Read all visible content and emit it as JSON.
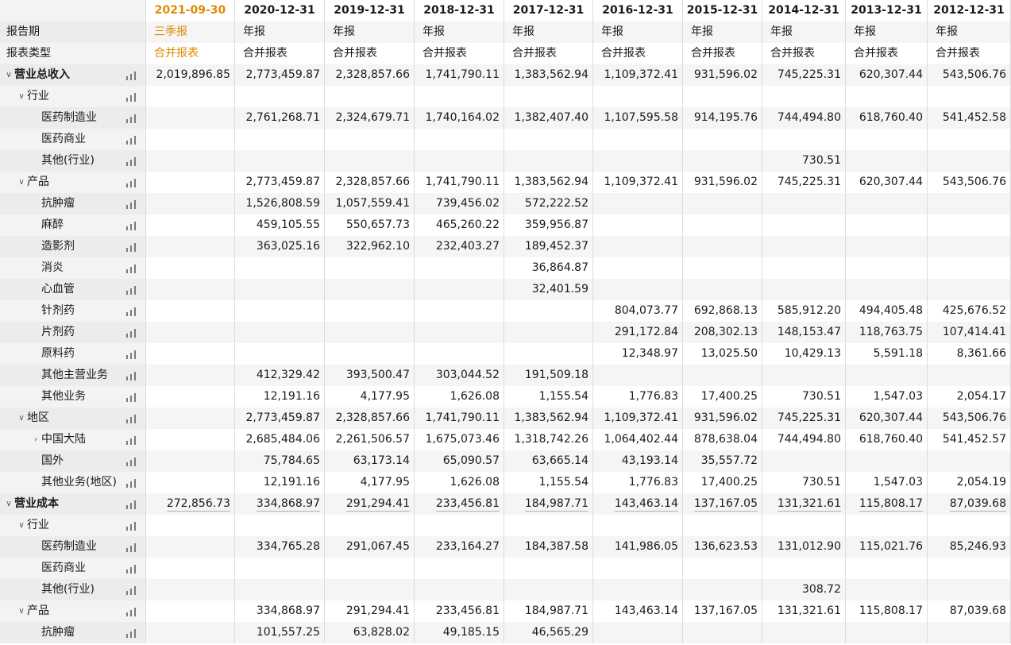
{
  "columns": [
    "2021-09-30",
    "2020-12-31",
    "2019-12-31",
    "2018-12-31",
    "2017-12-31",
    "2016-12-31",
    "2015-12-31",
    "2014-12-31",
    "2013-12-31",
    "2012-12-31"
  ],
  "highlight_column": 0,
  "accent_color": "#e08a00",
  "rows": [
    {
      "label": "报告期",
      "values": [
        "三季报",
        "年报",
        "年报",
        "年报",
        "年报",
        "年报",
        "年报",
        "年报",
        "年报",
        "年报"
      ],
      "indent": 0,
      "text_row": true
    },
    {
      "label": "报表类型",
      "values": [
        "合并报表",
        "合并报表",
        "合并报表",
        "合并报表",
        "合并报表",
        "合并报表",
        "合并报表",
        "合并报表",
        "合并报表",
        "合并报表"
      ],
      "indent": 0,
      "text_row": true
    },
    {
      "label": "营业总收入",
      "values": [
        "2,019,896.85",
        "2,773,459.87",
        "2,328,857.66",
        "1,741,790.11",
        "1,383,562.94",
        "1,109,372.41",
        "931,596.02",
        "745,225.31",
        "620,307.44",
        "543,506.76"
      ],
      "indent": 0,
      "toggle": "v",
      "bold": true,
      "chart": true
    },
    {
      "label": "行业",
      "values": [
        "",
        "",
        "",
        "",
        "",
        "",
        "",
        "",
        "",
        ""
      ],
      "indent": 1,
      "toggle": "v",
      "chart": true
    },
    {
      "label": "医药制造业",
      "values": [
        "",
        "2,761,268.71",
        "2,324,679.71",
        "1,740,164.02",
        "1,382,407.40",
        "1,107,595.58",
        "914,195.76",
        "744,494.80",
        "618,760.40",
        "541,452.58"
      ],
      "indent": 2,
      "chart": true
    },
    {
      "label": "医药商业",
      "values": [
        "",
        "",
        "",
        "",
        "",
        "",
        "",
        "",
        "",
        ""
      ],
      "indent": 2,
      "chart": true
    },
    {
      "label": "其他(行业)",
      "values": [
        "",
        "",
        "",
        "",
        "",
        "",
        "",
        "730.51",
        "",
        ""
      ],
      "indent": 2,
      "chart": true
    },
    {
      "label": "产品",
      "values": [
        "",
        "2,773,459.87",
        "2,328,857.66",
        "1,741,790.11",
        "1,383,562.94",
        "1,109,372.41",
        "931,596.02",
        "745,225.31",
        "620,307.44",
        "543,506.76"
      ],
      "indent": 1,
      "toggle": "v",
      "chart": true
    },
    {
      "label": "抗肿瘤",
      "values": [
        "",
        "1,526,808.59",
        "1,057,559.41",
        "739,456.02",
        "572,222.52",
        "",
        "",
        "",
        "",
        ""
      ],
      "indent": 2,
      "chart": true
    },
    {
      "label": "麻醉",
      "values": [
        "",
        "459,105.55",
        "550,657.73",
        "465,260.22",
        "359,956.87",
        "",
        "",
        "",
        "",
        ""
      ],
      "indent": 2,
      "chart": true
    },
    {
      "label": "造影剂",
      "values": [
        "",
        "363,025.16",
        "322,962.10",
        "232,403.27",
        "189,452.37",
        "",
        "",
        "",
        "",
        ""
      ],
      "indent": 2,
      "chart": true
    },
    {
      "label": "消炎",
      "values": [
        "",
        "",
        "",
        "",
        "36,864.87",
        "",
        "",
        "",
        "",
        ""
      ],
      "indent": 2,
      "chart": true
    },
    {
      "label": "心血管",
      "values": [
        "",
        "",
        "",
        "",
        "32,401.59",
        "",
        "",
        "",
        "",
        ""
      ],
      "indent": 2,
      "chart": true
    },
    {
      "label": "针剂药",
      "values": [
        "",
        "",
        "",
        "",
        "",
        "804,073.77",
        "692,868.13",
        "585,912.20",
        "494,405.48",
        "425,676.52"
      ],
      "indent": 2,
      "chart": true
    },
    {
      "label": "片剂药",
      "values": [
        "",
        "",
        "",
        "",
        "",
        "291,172.84",
        "208,302.13",
        "148,153.47",
        "118,763.75",
        "107,414.41"
      ],
      "indent": 2,
      "chart": true
    },
    {
      "label": "原料药",
      "values": [
        "",
        "",
        "",
        "",
        "",
        "12,348.97",
        "13,025.50",
        "10,429.13",
        "5,591.18",
        "8,361.66"
      ],
      "indent": 2,
      "chart": true
    },
    {
      "label": "其他主营业务",
      "values": [
        "",
        "412,329.42",
        "393,500.47",
        "303,044.52",
        "191,509.18",
        "",
        "",
        "",
        "",
        ""
      ],
      "indent": 2,
      "chart": true
    },
    {
      "label": "其他业务",
      "values": [
        "",
        "12,191.16",
        "4,177.95",
        "1,626.08",
        "1,155.54",
        "1,776.83",
        "17,400.25",
        "730.51",
        "1,547.03",
        "2,054.17"
      ],
      "indent": 2,
      "chart": true
    },
    {
      "label": "地区",
      "values": [
        "",
        "2,773,459.87",
        "2,328,857.66",
        "1,741,790.11",
        "1,383,562.94",
        "1,109,372.41",
        "931,596.02",
        "745,225.31",
        "620,307.44",
        "543,506.76"
      ],
      "indent": 1,
      "toggle": "v",
      "chart": true
    },
    {
      "label": "中国大陆",
      "values": [
        "",
        "2,685,484.06",
        "2,261,506.57",
        "1,675,073.46",
        "1,318,742.26",
        "1,064,402.44",
        "878,638.04",
        "744,494.80",
        "618,760.40",
        "541,452.57"
      ],
      "indent": 2,
      "toggle": ">",
      "chart": true
    },
    {
      "label": "国外",
      "values": [
        "",
        "75,784.65",
        "63,173.14",
        "65,090.57",
        "63,665.14",
        "43,193.14",
        "35,557.72",
        "",
        "",
        ""
      ],
      "indent": 2,
      "chart": true
    },
    {
      "label": "其他业务(地区)",
      "values": [
        "",
        "12,191.16",
        "4,177.95",
        "1,626.08",
        "1,155.54",
        "1,776.83",
        "17,400.25",
        "730.51",
        "1,547.03",
        "2,054.19"
      ],
      "indent": 2,
      "chart": true
    },
    {
      "label": "营业成本",
      "values": [
        "272,856.73",
        "334,868.97",
        "291,294.41",
        "233,456.81",
        "184,987.71",
        "143,463.14",
        "137,167.05",
        "131,321.61",
        "115,808.17",
        "87,039.68"
      ],
      "indent": 0,
      "toggle": "v",
      "bold": true,
      "chart": true,
      "underline": true
    },
    {
      "label": "行业",
      "values": [
        "",
        "",
        "",
        "",
        "",
        "",
        "",
        "",
        "",
        ""
      ],
      "indent": 1,
      "toggle": "v",
      "chart": true
    },
    {
      "label": "医药制造业",
      "values": [
        "",
        "334,765.28",
        "291,067.45",
        "233,164.27",
        "184,387.58",
        "141,986.05",
        "136,623.53",
        "131,012.90",
        "115,021.76",
        "85,246.93"
      ],
      "indent": 2,
      "chart": true
    },
    {
      "label": "医药商业",
      "values": [
        "",
        "",
        "",
        "",
        "",
        "",
        "",
        "",
        "",
        ""
      ],
      "indent": 2,
      "chart": true
    },
    {
      "label": "其他(行业)",
      "values": [
        "",
        "",
        "",
        "",
        "",
        "",
        "",
        "308.72",
        "",
        ""
      ],
      "indent": 2,
      "chart": true
    },
    {
      "label": "产品",
      "values": [
        "",
        "334,868.97",
        "291,294.41",
        "233,456.81",
        "184,987.71",
        "143,463.14",
        "137,167.05",
        "131,321.61",
        "115,808.17",
        "87,039.68"
      ],
      "indent": 1,
      "toggle": "v",
      "chart": true
    },
    {
      "label": "抗肿瘤",
      "values": [
        "",
        "101,557.25",
        "63,828.02",
        "49,185.15",
        "46,565.29",
        "",
        "",
        "",
        "",
        ""
      ],
      "indent": 2,
      "chart": true
    }
  ]
}
